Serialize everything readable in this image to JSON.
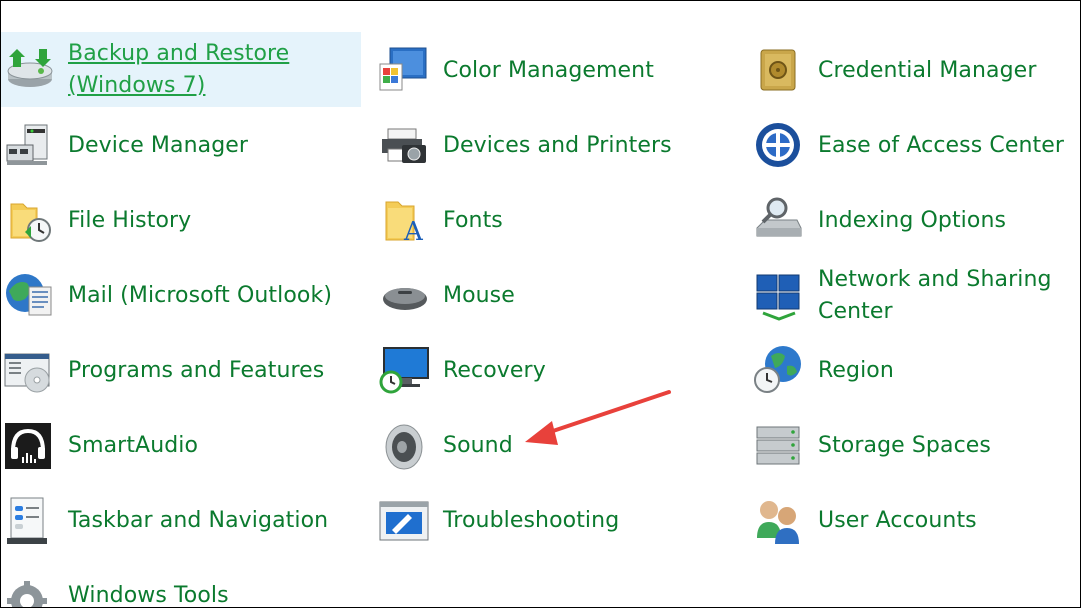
{
  "accent_color": "#0b7a2e",
  "hover_color": "#e5f3fb",
  "arrow_color": "#e8413b",
  "columns": [
    {
      "items": [
        {
          "label": "Backup and Restore (Windows 7)",
          "icon": "backup-restore-icon",
          "hovered": true
        },
        {
          "label": "Device Manager",
          "icon": "device-manager-icon"
        },
        {
          "label": "File History",
          "icon": "file-history-icon"
        },
        {
          "label": "Mail (Microsoft Outlook)",
          "icon": "mail-icon"
        },
        {
          "label": "Programs and Features",
          "icon": "programs-features-icon"
        },
        {
          "label": "SmartAudio",
          "icon": "headphones-icon"
        },
        {
          "label": "Taskbar and Navigation",
          "icon": "taskbar-icon"
        },
        {
          "label": "Windows Tools",
          "icon": "gear-icon"
        }
      ]
    },
    {
      "items": [
        {
          "label": "Color Management",
          "icon": "color-management-icon"
        },
        {
          "label": "Devices and Printers",
          "icon": "printer-icon"
        },
        {
          "label": "Fonts",
          "icon": "fonts-folder-icon"
        },
        {
          "label": "Mouse",
          "icon": "mouse-icon"
        },
        {
          "label": "Recovery",
          "icon": "recovery-icon"
        },
        {
          "label": "Sound",
          "icon": "speaker-icon"
        },
        {
          "label": "Troubleshooting",
          "icon": "troubleshooting-icon"
        }
      ]
    },
    {
      "items": [
        {
          "label": "Credential Manager",
          "icon": "vault-icon"
        },
        {
          "label": "Ease of Access Center",
          "icon": "ease-of-access-icon"
        },
        {
          "label": "Indexing Options",
          "icon": "indexing-icon"
        },
        {
          "label": "Network and Sharing Center",
          "icon": "network-icon"
        },
        {
          "label": "Region",
          "icon": "globe-clock-icon"
        },
        {
          "label": "Storage Spaces",
          "icon": "storage-spaces-icon"
        },
        {
          "label": "User Accounts",
          "icon": "users-icon"
        }
      ]
    }
  ]
}
